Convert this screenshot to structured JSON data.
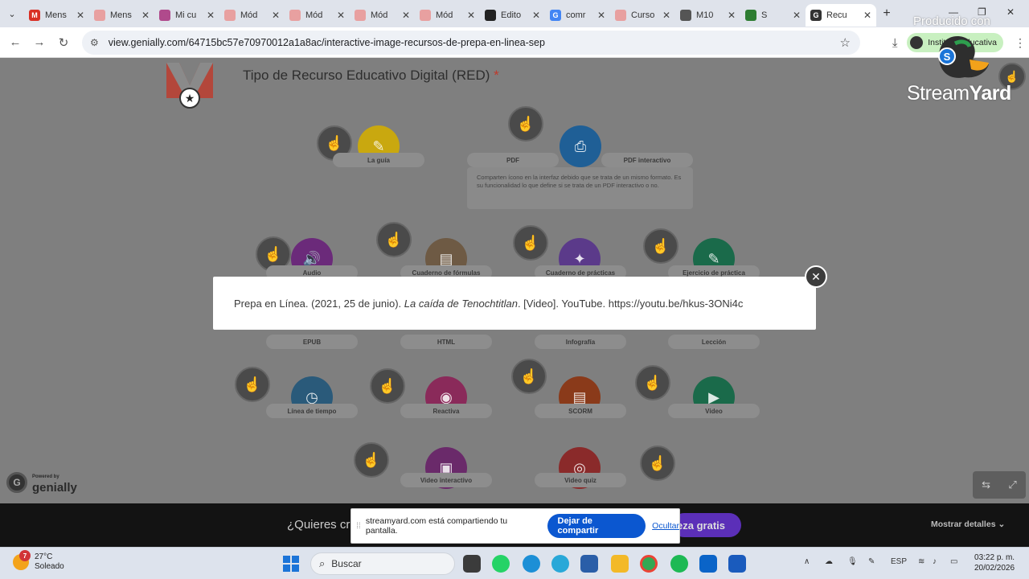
{
  "browser": {
    "tabs": [
      {
        "label": "Mens",
        "fav": "M",
        "color": "#d93025"
      },
      {
        "label": "Mens",
        "fav": "",
        "color": "#e8a0a0"
      },
      {
        "label": "Mi cu",
        "fav": "",
        "color": "#b04a8c"
      },
      {
        "label": "Mód",
        "fav": "",
        "color": "#e8a0a0"
      },
      {
        "label": "Mód",
        "fav": "",
        "color": "#e8a0a0"
      },
      {
        "label": "Mód",
        "fav": "",
        "color": "#e8a0a0"
      },
      {
        "label": "Mód",
        "fav": "",
        "color": "#e8a0a0"
      },
      {
        "label": "Edito",
        "fav": "",
        "color": "#222222"
      },
      {
        "label": "comr",
        "fav": "G",
        "color": "#4285f4"
      },
      {
        "label": "Curso",
        "fav": "",
        "color": "#e8a0a0"
      },
      {
        "label": "M10",
        "fav": "",
        "color": "#555555"
      },
      {
        "label": "S",
        "fav": "",
        "color": "#2e7d32"
      },
      {
        "label": "Recu",
        "fav": "G",
        "color": "#333333"
      }
    ],
    "url": "view.genially.com/64715bc57e70970012a1a8ac/interactive-image-recursos-de-prepa-en-linea-sep",
    "profile_label": "Instituto Educativa"
  },
  "page": {
    "title": "Tipo de Recurso Educativo Digital (RED)",
    "required_mark": "*",
    "pdf_note": "Comparten ícono en la interfaz debido que se trata de un mismo formato. Es su funcionalidad lo que define si se trata de un PDF interactivo o no.",
    "items": [
      {
        "label": "La guía",
        "color": "#c9a80f"
      },
      {
        "label": "PDF",
        "color": "#1f5f96"
      },
      {
        "label": "PDF interactivo",
        "color": ""
      },
      {
        "label": "Audio",
        "color": "#6b2a7a"
      },
      {
        "label": "Cuaderno de fórmulas",
        "color": "#6e5a44"
      },
      {
        "label": "Cuaderno de prácticas",
        "color": "#5b3a8a"
      },
      {
        "label": "Ejercicio de práctica",
        "color": "#1a6a4a"
      },
      {
        "label": "EPUB",
        "color": "#4f7a2a"
      },
      {
        "label": "HTML",
        "color": "#4f7a2a"
      },
      {
        "label": "Infografía",
        "color": "#8a3a20"
      },
      {
        "label": "Lección",
        "color": "#1a6a6a"
      },
      {
        "label": "Línea de tiempo",
        "color": "#2a5a7a"
      },
      {
        "label": "Reactiva",
        "color": "#8a2a5a"
      },
      {
        "label": "SCORM",
        "color": "#8a3a1a"
      },
      {
        "label": "Video",
        "color": "#1a6a4a"
      },
      {
        "label": "Video interactivo",
        "color": "#6a2a6a"
      },
      {
        "label": "Video quiz",
        "color": "#8a2a2a"
      }
    ],
    "genially_powered": "Powered by",
    "genially_brand": "genially"
  },
  "modal": {
    "text_before": "Prepa en Línea. (2021, 25 de junio). ",
    "text_italic": "La caída de Tenochtitlan",
    "text_after": ". [Video]. YouTube. https://youtu.be/hkus-3ONi4c"
  },
  "streamyard": {
    "produced": "Producido con",
    "brand_a": "Stream",
    "brand_b": "Yard"
  },
  "banner": {
    "question": "¿Quieres cr",
    "cta": "eza gratis",
    "details": "Mostrar detalles"
  },
  "sharebar": {
    "message": "streamyard.com está compartiendo tu pantalla.",
    "stop": "Dejar de compartir",
    "hide": "Ocultar"
  },
  "taskbar": {
    "temp": "27°C",
    "condition": "Soleado",
    "weather_badge": "7",
    "search": "Buscar",
    "lang": "ESP",
    "time": "03:22 p. m.",
    "date": "20/02/2026"
  }
}
